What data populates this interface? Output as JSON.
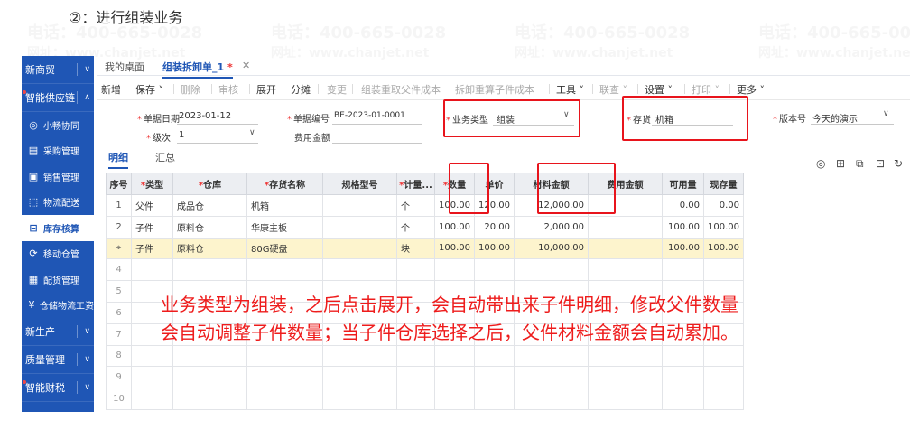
{
  "heading": "②：进行组装业务",
  "watermarks": {
    "phone": "电话：400-665-0028",
    "site": "网址：www.chanjet.net"
  },
  "sidebar": {
    "items": [
      {
        "label": "新商贸",
        "chev": "∨",
        "top": true
      },
      {
        "label": "智能供应链",
        "chev": "∧",
        "top": true,
        "dot": true
      },
      {
        "label": "小畅协同",
        "icon": "◎"
      },
      {
        "label": "采购管理",
        "icon": "▤"
      },
      {
        "label": "销售管理",
        "icon": "▣"
      },
      {
        "label": "物流配送",
        "icon": "⬚"
      },
      {
        "label": "库存核算",
        "icon": "⊟",
        "active": true
      },
      {
        "label": "移动仓管",
        "icon": "⟳"
      },
      {
        "label": "配货管理",
        "icon": "▦"
      },
      {
        "label": "仓储物流工资",
        "icon": "¥"
      },
      {
        "label": "新生产",
        "chev": "∨",
        "top": true
      },
      {
        "label": "质量管理",
        "chev": "∨",
        "top": true
      },
      {
        "label": "智能财税",
        "chev": "∨",
        "top": true,
        "dot": true
      }
    ]
  },
  "tabs": {
    "home": "我的桌面",
    "active": "组装拆卸单_1",
    "modified": "*",
    "close": "✕"
  },
  "toolbar": [
    {
      "label": "新增"
    },
    {
      "label": "保存 ˅"
    },
    {
      "label": "删除",
      "dis": true
    },
    {
      "label": "审核",
      "dis": true
    },
    {
      "label": "展开"
    },
    {
      "label": "分摊"
    },
    {
      "label": "变更",
      "dis": true
    },
    {
      "label": "组装重取父件成本",
      "dis": true
    },
    {
      "label": "拆卸重算子件成本",
      "dis": true
    },
    {
      "label": "工具 ˅"
    },
    {
      "label": "联查 ˅",
      "dis": true
    },
    {
      "label": "设置 ˅"
    },
    {
      "label": "打印 ˅",
      "dis": true
    },
    {
      "label": "更多 ˅"
    }
  ],
  "form": {
    "date_label": "单据日期",
    "date_value": "2023-01-12",
    "code_label": "单据编号",
    "code_value": "BE-2023-01-0001",
    "biztype_label": "业务类型",
    "biztype_value": "组装",
    "inventory_label": "存货",
    "inventory_value": "机箱",
    "version_label": "版本号",
    "version_value": "今天的演示",
    "level_label": "级次",
    "level_value": "1",
    "fee_label": "费用金额"
  },
  "subtabs": {
    "detail": "明细",
    "summary": "汇总"
  },
  "toolicons": [
    "◎",
    "⊞",
    "⧉",
    "⊡",
    "↻"
  ],
  "table": {
    "headers": [
      "序号",
      "类型",
      "仓库",
      "存货名称",
      "规格型号",
      "计量...",
      "数量",
      "单价",
      "材料金额",
      "费用金额",
      "可用量",
      "现存量"
    ],
    "rows": [
      [
        "1",
        "父件",
        "成品仓",
        "机箱",
        "",
        "个",
        "100.00",
        "120.00",
        "12,000.00",
        "",
        "0.00",
        "0.00"
      ],
      [
        "2",
        "子件",
        "原料仓",
        "华康主板",
        "",
        "个",
        "100.00",
        "20.00",
        "2,000.00",
        "",
        "100.00",
        "100.00"
      ],
      [
        "3",
        "子件",
        "原料仓",
        "80G硬盘",
        "",
        "块",
        "100.00",
        "100.00",
        "10,000.00",
        "",
        "100.00",
        "100.00"
      ],
      [
        "4"
      ],
      [
        "5"
      ],
      [
        "6"
      ],
      [
        "7"
      ],
      [
        "8"
      ],
      [
        "9"
      ],
      [
        "10"
      ]
    ]
  },
  "row3_icon": "⌖",
  "note": {
    "line1": "业务类型为组装，之后点击展开，会自动带出来子件明细，修改父件数量",
    "line2": "会自动调整子件数量；当子件仓库选择之后，父件材料金额会自动累加。"
  },
  "colors": {
    "brand": "#1f56b5",
    "highlight": "#e8141c",
    "row_highlight": "#fdf4cd"
  }
}
